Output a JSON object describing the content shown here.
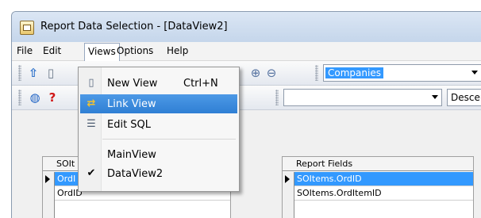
{
  "window": {
    "title": "Report Data Selection - [DataView2]",
    "icon": "report-app-icon"
  },
  "menubar": {
    "file": "File",
    "edit": "Edit",
    "views": "Views",
    "options": "Options",
    "help": "Help"
  },
  "toolbar": {
    "table_combo_value": "Companies",
    "search_combo_value": "",
    "sort_combo_value": "Descen"
  },
  "views_menu": {
    "items": [
      {
        "label": "New View",
        "shortcut": "Ctrl+N",
        "icon": "new-document-icon"
      },
      {
        "label": "Link View",
        "shortcut": "",
        "icon": "link-arrows-icon"
      },
      {
        "label": "Edit SQL",
        "shortcut": "",
        "icon": "sql-document-icon"
      },
      {
        "label": "MainView",
        "shortcut": "",
        "icon": ""
      },
      {
        "label": "DataView2",
        "shortcut": "",
        "icon": "checkmark-icon"
      }
    ]
  },
  "left_grid": {
    "header": "SOIt",
    "rows": [
      "OrdI",
      "OrdID"
    ]
  },
  "right_grid": {
    "header": "Report Fields",
    "rows": [
      "SOItems.OrdID",
      "SOItems.OrdItemID"
    ]
  },
  "colors": {
    "selection": "#3399ff",
    "menu_highlight": "#3d8ad9"
  }
}
